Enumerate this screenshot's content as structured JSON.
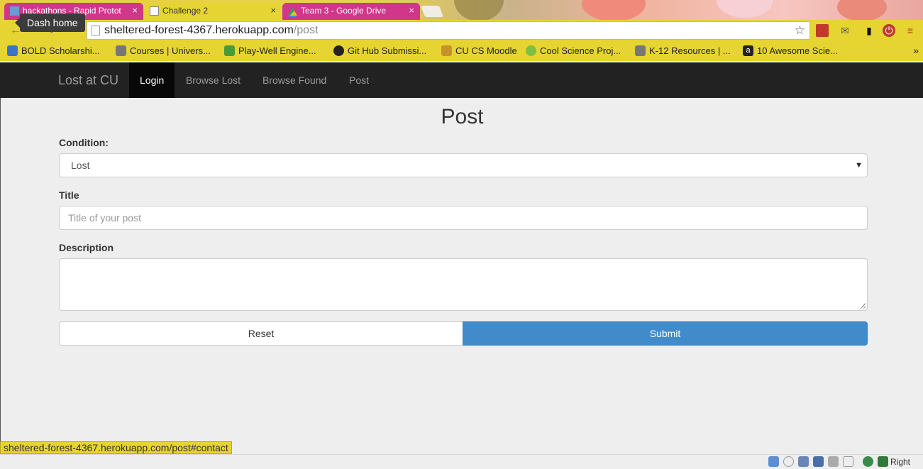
{
  "browser": {
    "tabs": [
      {
        "label": "hackathons - Rapid Protot",
        "close": "×"
      },
      {
        "label": "Challenge 2",
        "close": "×"
      },
      {
        "label": "Team 3 - Google Drive",
        "close": "×"
      }
    ],
    "tooltip": "Dash home",
    "url": {
      "host": "sheltered-forest-4367.herokuapp.com",
      "path": "/post"
    },
    "bookmarks": [
      "BOLD Scholarshi...",
      "Courses | Univers...",
      "Play-Well Engine...",
      "Git Hub Submissi...",
      "CU CS Moodle",
      "Cool Science Proj...",
      "K-12 Resources | ...",
      "10 Awesome Scie..."
    ],
    "bookmarks_overflow": "»",
    "status_url": "sheltered-forest-4367.herokuapp.com/post#contact",
    "tray_label": "Right Ctrl"
  },
  "navbar": {
    "brand": "Lost at CU",
    "links": [
      "Login",
      "Browse Lost",
      "Browse Found",
      "Post"
    ],
    "active": "Login"
  },
  "form": {
    "heading": "Post",
    "condition_label": "Condition:",
    "condition_value": "Lost",
    "title_label": "Title",
    "title_placeholder": "Title of your post",
    "description_label": "Description",
    "reset_label": "Reset",
    "submit_label": "Submit"
  },
  "colors": {
    "theme": "#e6d432",
    "navbar": "#222222",
    "submit": "#428bca"
  }
}
